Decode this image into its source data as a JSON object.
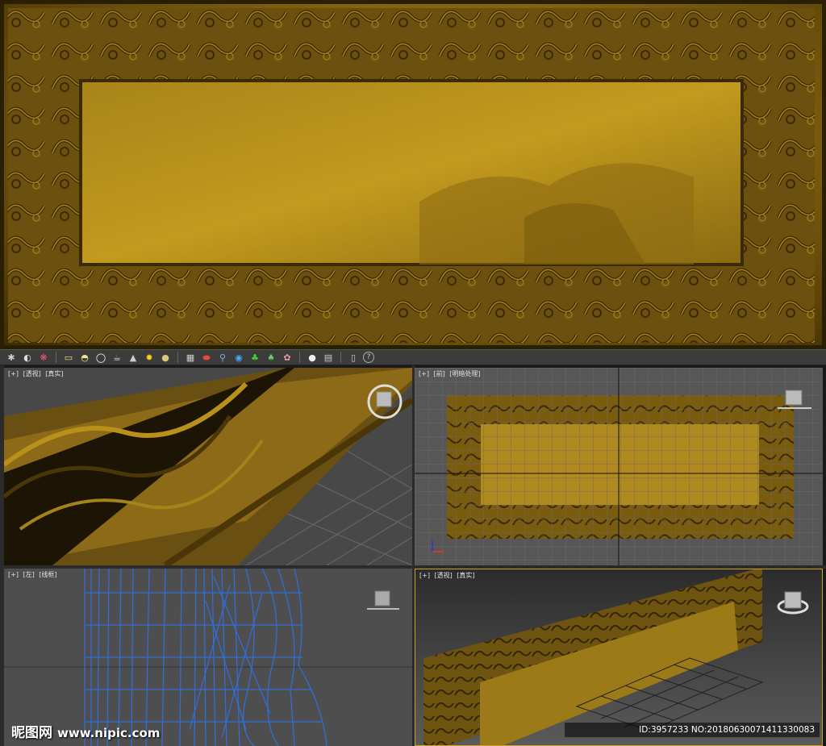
{
  "toolbar": {
    "icons": [
      "paw-icon",
      "half-moon-icon",
      "teapot-group-icon",
      "plane-icon",
      "hemisphere-icon",
      "sphere-icon",
      "teapot-icon",
      "cone-icon",
      "sun-icon",
      "sphere-light-icon",
      "checker-icon",
      "capsule-icon",
      "figure-icon",
      "globe-icon",
      "plant-icon",
      "tree-icon",
      "shell-icon",
      "material-ball-icon",
      "grid-icon",
      "viewport-icon",
      "help-icon"
    ]
  },
  "viewports": {
    "top_left": {
      "bracket": "[+]",
      "view": "[透视]",
      "shade": "[真实]"
    },
    "top_right": {
      "bracket": "[+]",
      "view": "[前]",
      "shade": "[明暗处理]"
    },
    "bottom_left": {
      "bracket": "[+]",
      "view": "[左]",
      "shade": "[线框]"
    },
    "bottom_right": {
      "bracket": "[+]",
      "view": "[透视]",
      "shade": "[真实]"
    }
  },
  "watermark": {
    "brand": "昵图网",
    "site": "www.nipic.com",
    "id_text": "ID:3957233 NO:20180630071411330083"
  },
  "colors": {
    "wood_light": "#b8901a",
    "wood_dark": "#4a3606",
    "wire_blue": "#2f6fe0",
    "active_border": "#c9a227"
  }
}
